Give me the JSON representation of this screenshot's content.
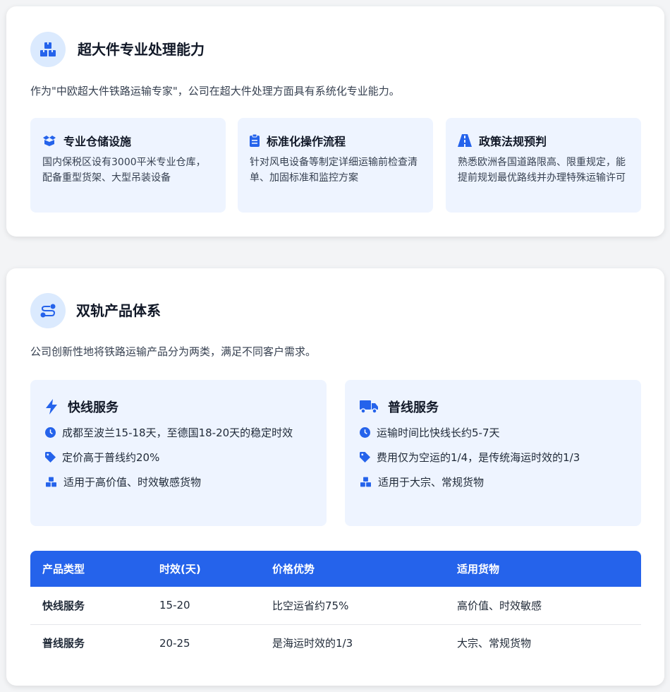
{
  "capability": {
    "title": "超大件专业处理能力",
    "icon": "boxes-icon",
    "description": "作为\"中欧超大件铁路运输专家\"，公司在超大件处理方面具有系统化专业能力。",
    "features": [
      {
        "icon": "box-open-icon",
        "title": "专业仓储设施",
        "text": "国内保税区设有3000平米专业仓库，配备重型货架、大型吊装设备"
      },
      {
        "icon": "clipboard-icon",
        "title": "标准化操作流程",
        "text": "针对风电设备等制定详细运输前检查清单、加固标准和监控方案"
      },
      {
        "icon": "road-icon",
        "title": "政策法规预判",
        "text": "熟悉欧洲各国道路限高、限重规定，能提前规划最优路线并办理特殊运输许可"
      }
    ]
  },
  "products": {
    "title": "双轨产品体系",
    "icon": "route-icon",
    "description": "公司创新性地将铁路运输产品分为两类，满足不同客户需求。",
    "services": [
      {
        "icon": "bolt-icon",
        "title": "快线服务",
        "bullets": [
          {
            "icon": "clock-icon",
            "text": "成都至波兰15-18天，至德国18-20天的稳定时效"
          },
          {
            "icon": "tag-icon",
            "text": "定价高于普线约20%"
          },
          {
            "icon": "boxes-icon",
            "text": "适用于高价值、时效敏感货物"
          }
        ]
      },
      {
        "icon": "truck-icon",
        "title": "普线服务",
        "bullets": [
          {
            "icon": "clock-icon",
            "text": "运输时间比快线长约5-7天"
          },
          {
            "icon": "tag-icon",
            "text": "费用仅为空运的1/4，是传统海运时效的1/3"
          },
          {
            "icon": "boxes-icon",
            "text": "适用于大宗、常规货物"
          }
        ]
      }
    ],
    "table": {
      "headers": [
        "产品类型",
        "时效(天)",
        "价格优势",
        "适用货物"
      ],
      "rows": [
        [
          "快线服务",
          "15-20",
          "比空运省约75%",
          "高价值、时效敏感"
        ],
        [
          "普线服务",
          "20-25",
          "是海运时效的1/3",
          "大宗、常规货物"
        ]
      ]
    }
  },
  "colors": {
    "accent": "#2563eb",
    "card_bg": "#eef4ff",
    "icon_circle": "#dbeafe",
    "page_bg": "#f3f4f6"
  }
}
